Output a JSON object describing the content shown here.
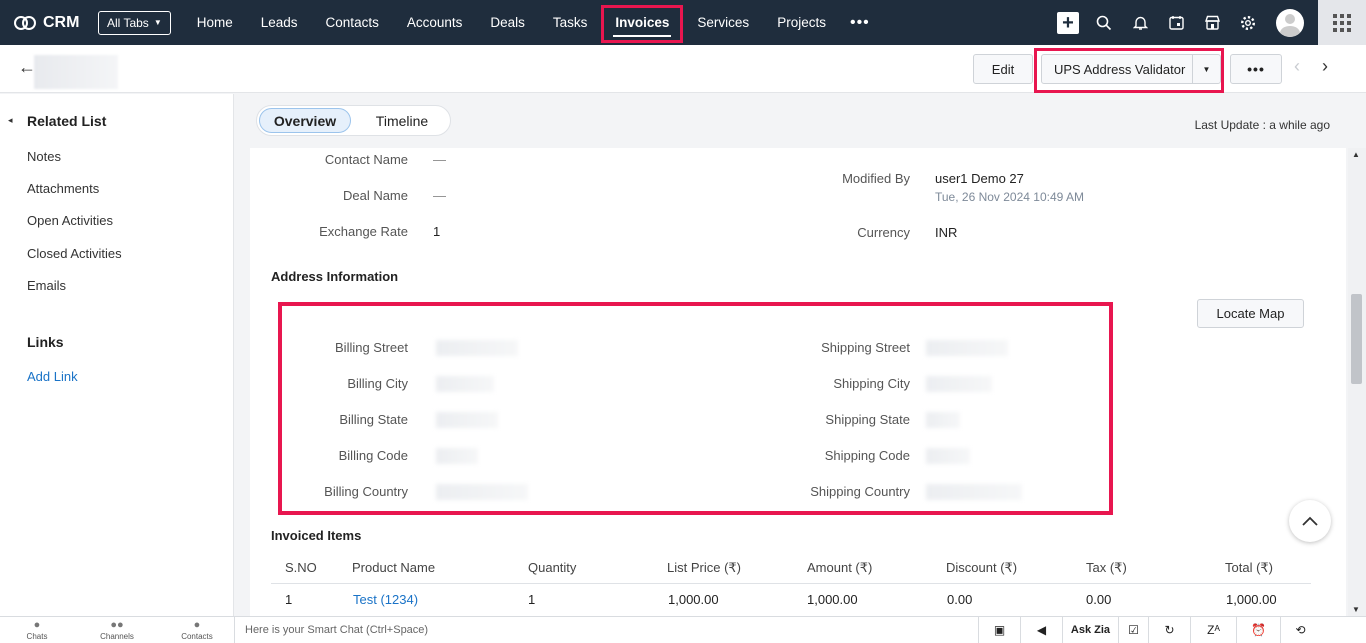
{
  "nav": {
    "brand": "CRM",
    "all_tabs": "All Tabs",
    "tabs": [
      "Home",
      "Leads",
      "Contacts",
      "Accounts",
      "Deals",
      "Tasks",
      "Invoices",
      "Services",
      "Projects"
    ],
    "active_tab": "Invoices",
    "more": "•••",
    "icons": [
      "plus-icon",
      "search-icon",
      "bell-icon",
      "calendar-icon",
      "store-icon",
      "gear-icon",
      "avatar",
      "apps-grid-icon"
    ]
  },
  "header": {
    "edit_label": "Edit",
    "ups_label": "UPS Address Validator",
    "more_label": "•••"
  },
  "sidebar": {
    "related_title": "Related List",
    "related_items": [
      "Notes",
      "Attachments",
      "Open Activities",
      "Closed Activities",
      "Emails"
    ],
    "links_title": "Links",
    "add_link": "Add Link"
  },
  "main": {
    "tab_overview": "Overview",
    "tab_timeline": "Timeline",
    "last_update": "Last Update : a while ago",
    "fields_left": [
      {
        "label": "Contact Name",
        "value": "—"
      },
      {
        "label": "Deal Name",
        "value": "—"
      },
      {
        "label": "Exchange Rate",
        "value": "1"
      }
    ],
    "modified_by_label": "Modified By",
    "modified_by_user": "user1 Demo 27",
    "modified_by_date": "Tue, 26 Nov 2024 10:49 AM",
    "currency_label": "Currency",
    "currency_value": "INR",
    "address_title": "Address Information",
    "locate_map": "Locate Map",
    "billing_labels": [
      "Billing Street",
      "Billing City",
      "Billing State",
      "Billing Code",
      "Billing Country"
    ],
    "shipping_labels": [
      "Shipping Street",
      "Shipping City",
      "Shipping State",
      "Shipping Code",
      "Shipping Country"
    ],
    "invoiced_title": "Invoiced Items",
    "table_headers": [
      "S.NO",
      "Product Name",
      "Quantity",
      "List Price (₹)",
      "Amount (₹)",
      "Discount (₹)",
      "Tax (₹)",
      "Total (₹)"
    ],
    "table_rows": [
      [
        "1",
        "Test (1234)",
        "1",
        "1,000.00",
        "1,000.00",
        "0.00",
        "0.00",
        "1,000.00"
      ]
    ]
  },
  "bottom": {
    "chats": "Chats",
    "channels": "Channels",
    "contacts": "Contacts",
    "smart_chat_placeholder": "Here is your Smart Chat (Ctrl+Space)",
    "ask_zia": "Ask Zia"
  }
}
